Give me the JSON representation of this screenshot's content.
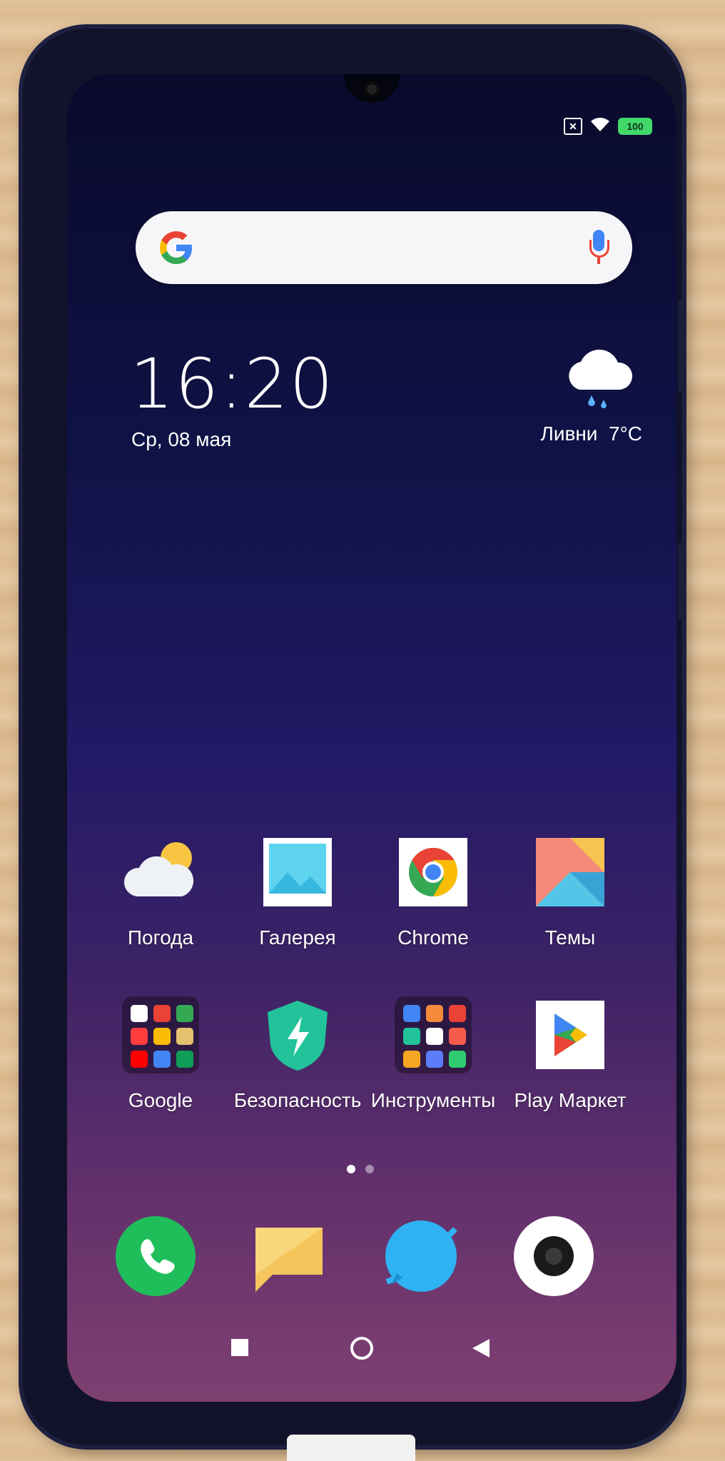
{
  "status_bar": {
    "battery_level": "100"
  },
  "search": {
    "logo": "G"
  },
  "clock": {
    "time": "16:20",
    "date": "Ср, 08 мая"
  },
  "weather": {
    "condition": "Ливни",
    "temperature": "7°C"
  },
  "apps_row1": [
    {
      "label": "Погода",
      "icon": "weather-app-icon"
    },
    {
      "label": "Галерея",
      "icon": "gallery-icon"
    },
    {
      "label": "Chrome",
      "icon": "chrome-icon"
    },
    {
      "label": "Темы",
      "icon": "themes-icon"
    }
  ],
  "apps_row2": [
    {
      "label": "Google",
      "icon": "google-folder-icon"
    },
    {
      "label": "Безопасность",
      "icon": "security-icon"
    },
    {
      "label": "Инструменты",
      "icon": "tools-folder-icon"
    },
    {
      "label": "Play Маркет",
      "icon": "play-market-icon"
    }
  ],
  "page_indicator": {
    "total": 2,
    "current": 1
  },
  "dock": [
    "phone-icon",
    "messages-icon",
    "browser-icon",
    "camera-icon"
  ],
  "navigation": [
    "recents-button",
    "home-button",
    "back-button"
  ]
}
